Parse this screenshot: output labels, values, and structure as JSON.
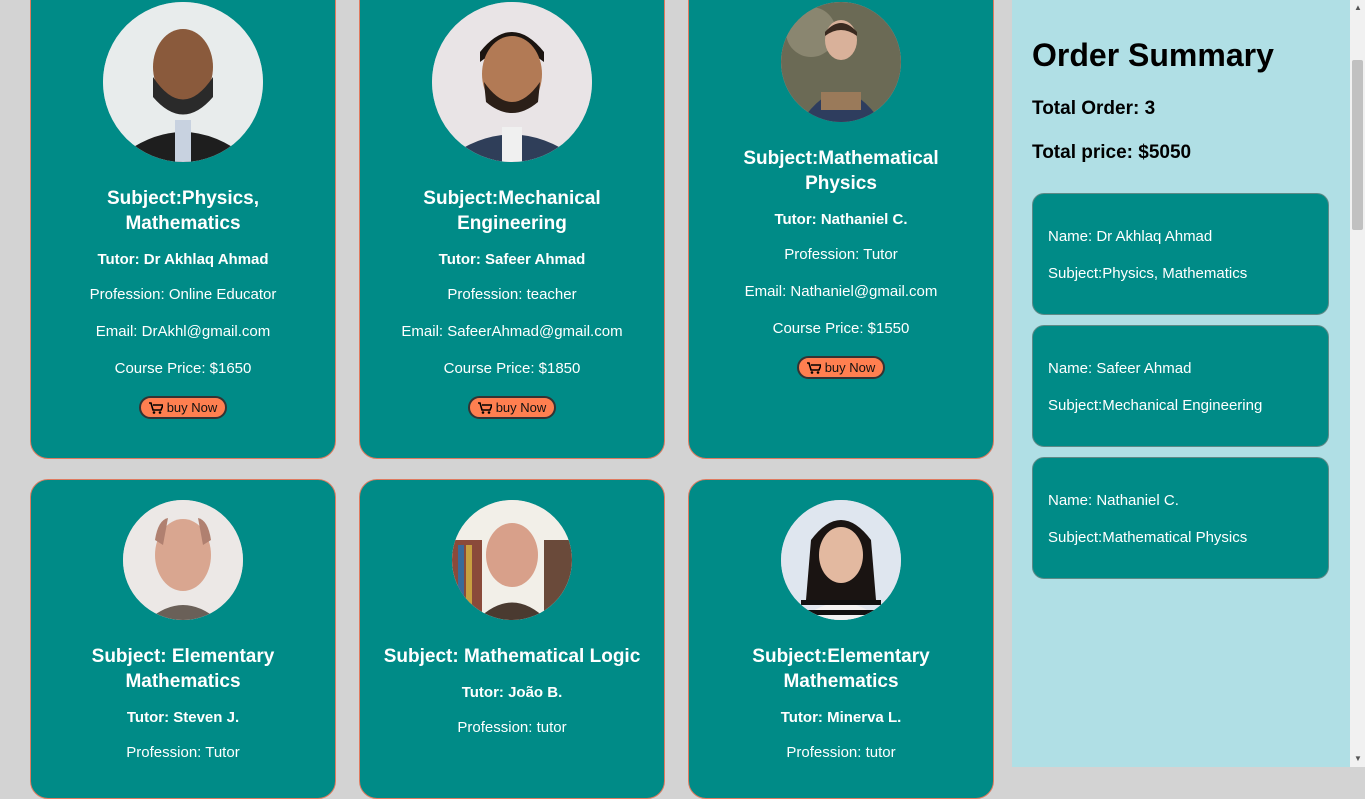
{
  "tutors": [
    {
      "subject": "Subject:Physics, Mathematics",
      "tutor": "Tutor: Dr Akhlaq Ahmad",
      "profession": "Profession: Online Educator",
      "email": "Email: DrAkhl@gmail.com",
      "price": "Course Price: $1650",
      "button": "buy Now"
    },
    {
      "subject": "Subject:Mechanical Engineering",
      "tutor": "Tutor: Safeer Ahmad",
      "profession": "Profession: teacher",
      "email": "Email: SafeerAhmad@gmail.com",
      "price": "Course Price: $1850",
      "button": "buy Now"
    },
    {
      "subject": "Subject:Mathematical Physics",
      "tutor": "Tutor: Nathaniel C.",
      "profession": "Profession: Tutor",
      "email": "Email: Nathaniel@gmail.com",
      "price": "Course Price: $1550",
      "button": "buy Now"
    },
    {
      "subject": "Subject: Elementary Mathematics",
      "tutor": "Tutor: Steven J.",
      "profession": "Profession: Tutor"
    },
    {
      "subject": "Subject: Mathematical Logic",
      "tutor": "Tutor: João B.",
      "profession": "Profession: tutor"
    },
    {
      "subject": "Subject:Elementary Mathematics",
      "tutor": "Tutor: Minerva L.",
      "profession": "Profession: tutor"
    }
  ],
  "summary": {
    "title": "Order Summary",
    "total_order": "Total Order: 3",
    "total_price": "Total price: $5050",
    "orders": [
      {
        "name": "Name: Dr Akhlaq Ahmad",
        "subject": "Subject:Physics, Mathematics"
      },
      {
        "name": "Name: Safeer Ahmad",
        "subject": "Subject:Mechanical Engineering"
      },
      {
        "name": "Name: Nathaniel C.",
        "subject": "Subject:Mathematical Physics"
      }
    ]
  },
  "colors": {
    "card": "#008b87",
    "button": "#ff7f50",
    "sidebar": "#b0dfe5",
    "page": "#d3d3d3"
  }
}
